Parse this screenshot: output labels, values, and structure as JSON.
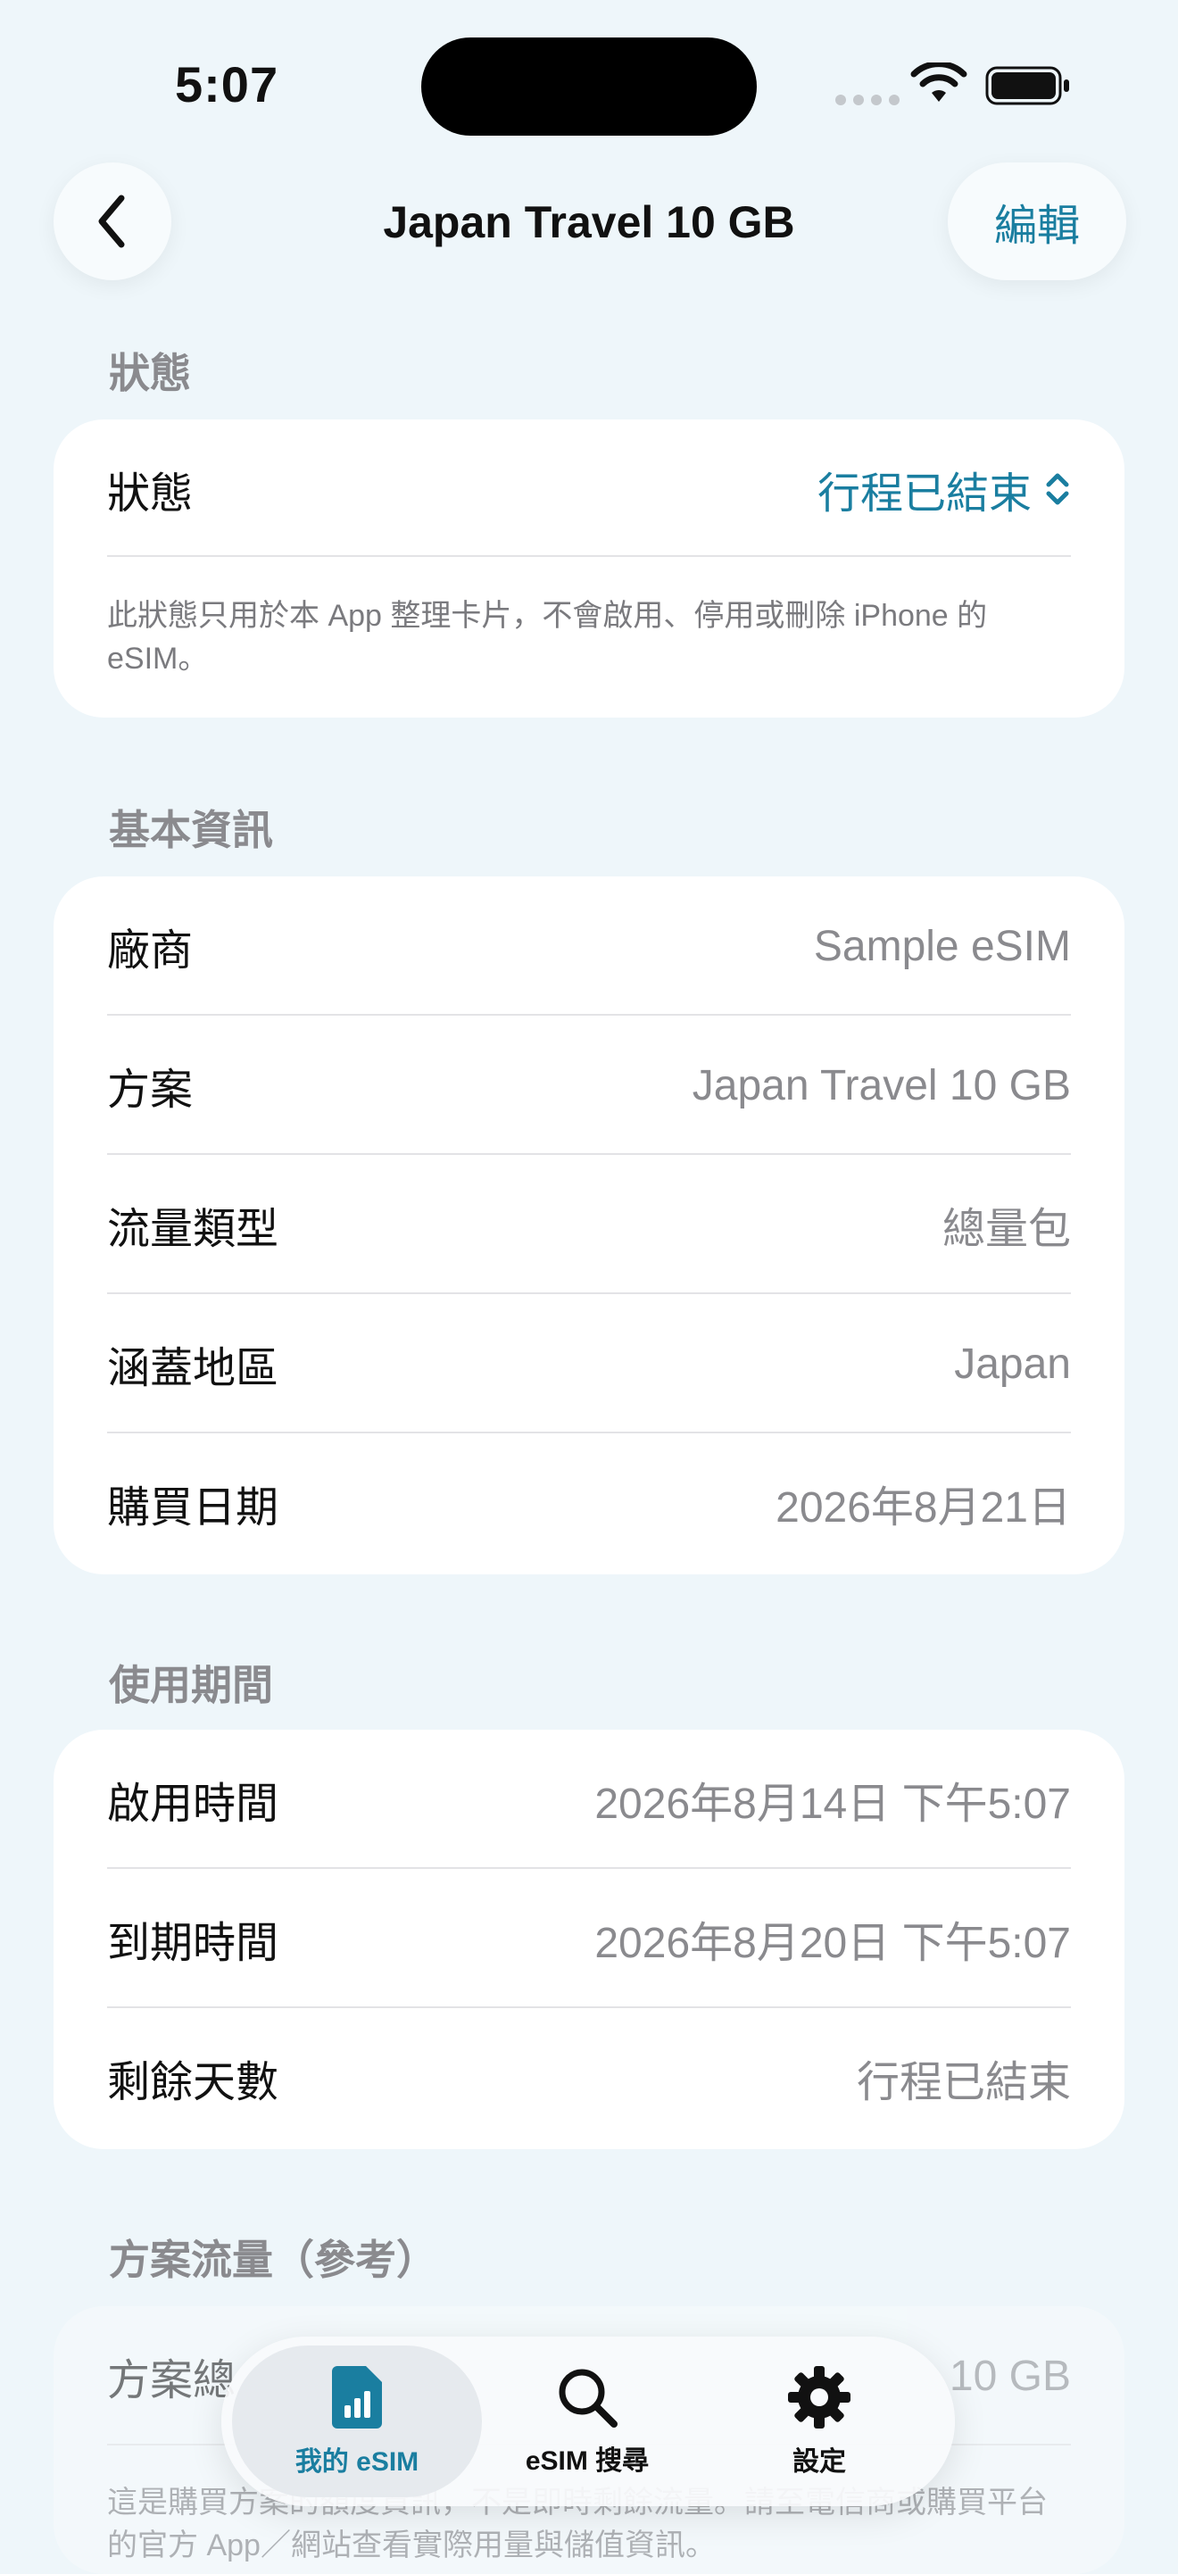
{
  "status_bar": {
    "time": "5:07"
  },
  "nav": {
    "title": "Japan Travel 10 GB",
    "edit_label": "編輯"
  },
  "sections": {
    "status": {
      "header": "狀態",
      "label": "狀態",
      "value": "行程已結束",
      "note": "此狀態只用於本 App 整理卡片，不會啟用、停用或刪除 iPhone 的 eSIM。"
    },
    "basic": {
      "header": "基本資訊",
      "rows": [
        {
          "label": "廠商",
          "value": "Sample eSIM"
        },
        {
          "label": "方案",
          "value": "Japan Travel 10 GB"
        },
        {
          "label": "流量類型",
          "value": "總量包"
        },
        {
          "label": "涵蓋地區",
          "value": "Japan"
        },
        {
          "label": "購買日期",
          "value": "2026年8月21日"
        }
      ]
    },
    "period": {
      "header": "使用期間",
      "rows": [
        {
          "label": "啟用時間",
          "value": "2026年8月14日 下午5:07"
        },
        {
          "label": "到期時間",
          "value": "2026年8月20日 下午5:07"
        },
        {
          "label": "剩餘天數",
          "value": "行程已結束"
        }
      ]
    },
    "data_plan": {
      "header": "方案流量（參考）",
      "label": "方案總",
      "value": "10 GB",
      "note": "這是購買方案的額度資訊，不是即時剩餘流量。請至電信商或購買平台的官方 App／網站查看實際用量與儲值資訊。"
    }
  },
  "tabbar": {
    "tabs": [
      {
        "label": "我的 eSIM",
        "icon": "sim-card-icon"
      },
      {
        "label": "eSIM 搜尋",
        "icon": "search-icon"
      },
      {
        "label": "設定",
        "icon": "gear-icon"
      }
    ]
  },
  "colors": {
    "accent": "#1a7ea0",
    "background": "#eef6fa",
    "card": "#ffffff",
    "secondary_text": "#8a8a8e"
  }
}
